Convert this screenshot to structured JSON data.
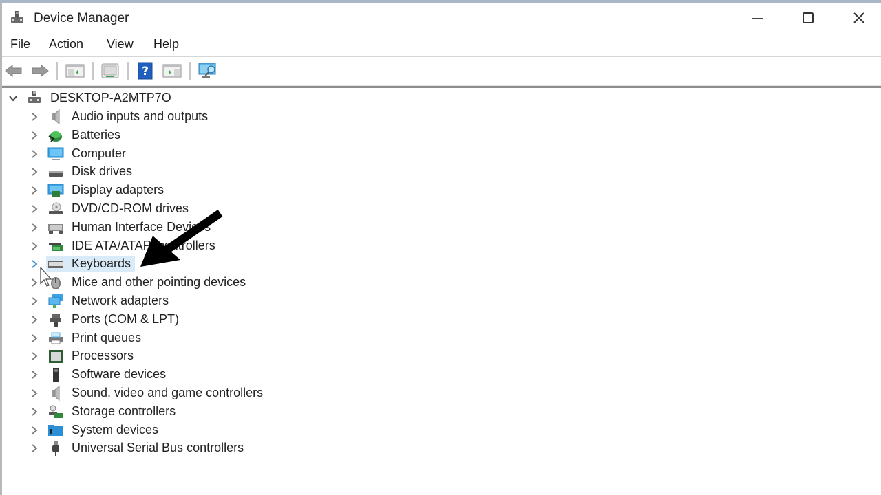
{
  "window": {
    "title": "Device Manager",
    "controls": {
      "minimize": "minimize",
      "maximize": "maximize",
      "close": "close"
    }
  },
  "menu": {
    "items": [
      {
        "label": "File"
      },
      {
        "label": "Action"
      },
      {
        "label": "View"
      },
      {
        "label": "Help"
      }
    ]
  },
  "toolbar": {
    "buttons": [
      {
        "icon": "back-arrow-icon",
        "tooltip": "Back"
      },
      {
        "icon": "forward-arrow-icon",
        "tooltip": "Forward"
      },
      {
        "icon": "show-hide-console-tree-icon",
        "tooltip": "Show/Hide Console Tree"
      },
      {
        "icon": "properties-icon",
        "tooltip": "Properties"
      },
      {
        "icon": "help-icon",
        "tooltip": "Help"
      },
      {
        "icon": "show-action-pane-icon",
        "tooltip": "Show/Hide Action Pane"
      },
      {
        "icon": "scan-hardware-icon",
        "tooltip": "Scan for hardware changes"
      }
    ]
  },
  "tree": {
    "root": {
      "label": "DESKTOP-A2MTP7O",
      "expanded": true
    },
    "selected_index": 8,
    "categories": [
      {
        "label": "Audio inputs and outputs",
        "icon": "speaker-icon"
      },
      {
        "label": "Batteries",
        "icon": "battery-icon"
      },
      {
        "label": "Computer",
        "icon": "monitor-icon"
      },
      {
        "label": "Disk drives",
        "icon": "disk-drive-icon"
      },
      {
        "label": "Display adapters",
        "icon": "display-adapter-icon"
      },
      {
        "label": "DVD/CD-ROM drives",
        "icon": "dvd-drive-icon"
      },
      {
        "label": "Human Interface Devices",
        "icon": "hid-icon"
      },
      {
        "label": "IDE ATA/ATAPI controllers",
        "icon": "ide-controller-icon"
      },
      {
        "label": "Keyboards",
        "icon": "keyboard-icon"
      },
      {
        "label": "Mice and other pointing devices",
        "icon": "mouse-icon"
      },
      {
        "label": "Network adapters",
        "icon": "network-adapter-icon"
      },
      {
        "label": "Ports (COM & LPT)",
        "icon": "port-icon"
      },
      {
        "label": "Print queues",
        "icon": "printer-icon"
      },
      {
        "label": "Processors",
        "icon": "processor-icon"
      },
      {
        "label": "Software devices",
        "icon": "software-device-icon"
      },
      {
        "label": "Sound, video and game controllers",
        "icon": "sound-controller-icon"
      },
      {
        "label": "Storage controllers",
        "icon": "storage-controller-icon"
      },
      {
        "label": "System devices",
        "icon": "system-devices-icon"
      },
      {
        "label": "Universal Serial Bus controllers",
        "icon": "usb-icon"
      }
    ]
  },
  "annotation": {
    "type": "arrow",
    "points_to": "Keyboards",
    "color": "#000000"
  },
  "colors": {
    "selection": "#d9ebf9",
    "chevron": "#7a7a7a",
    "chevron_hover": "#2b8ad6",
    "help_blue": "#1f5fbf"
  }
}
